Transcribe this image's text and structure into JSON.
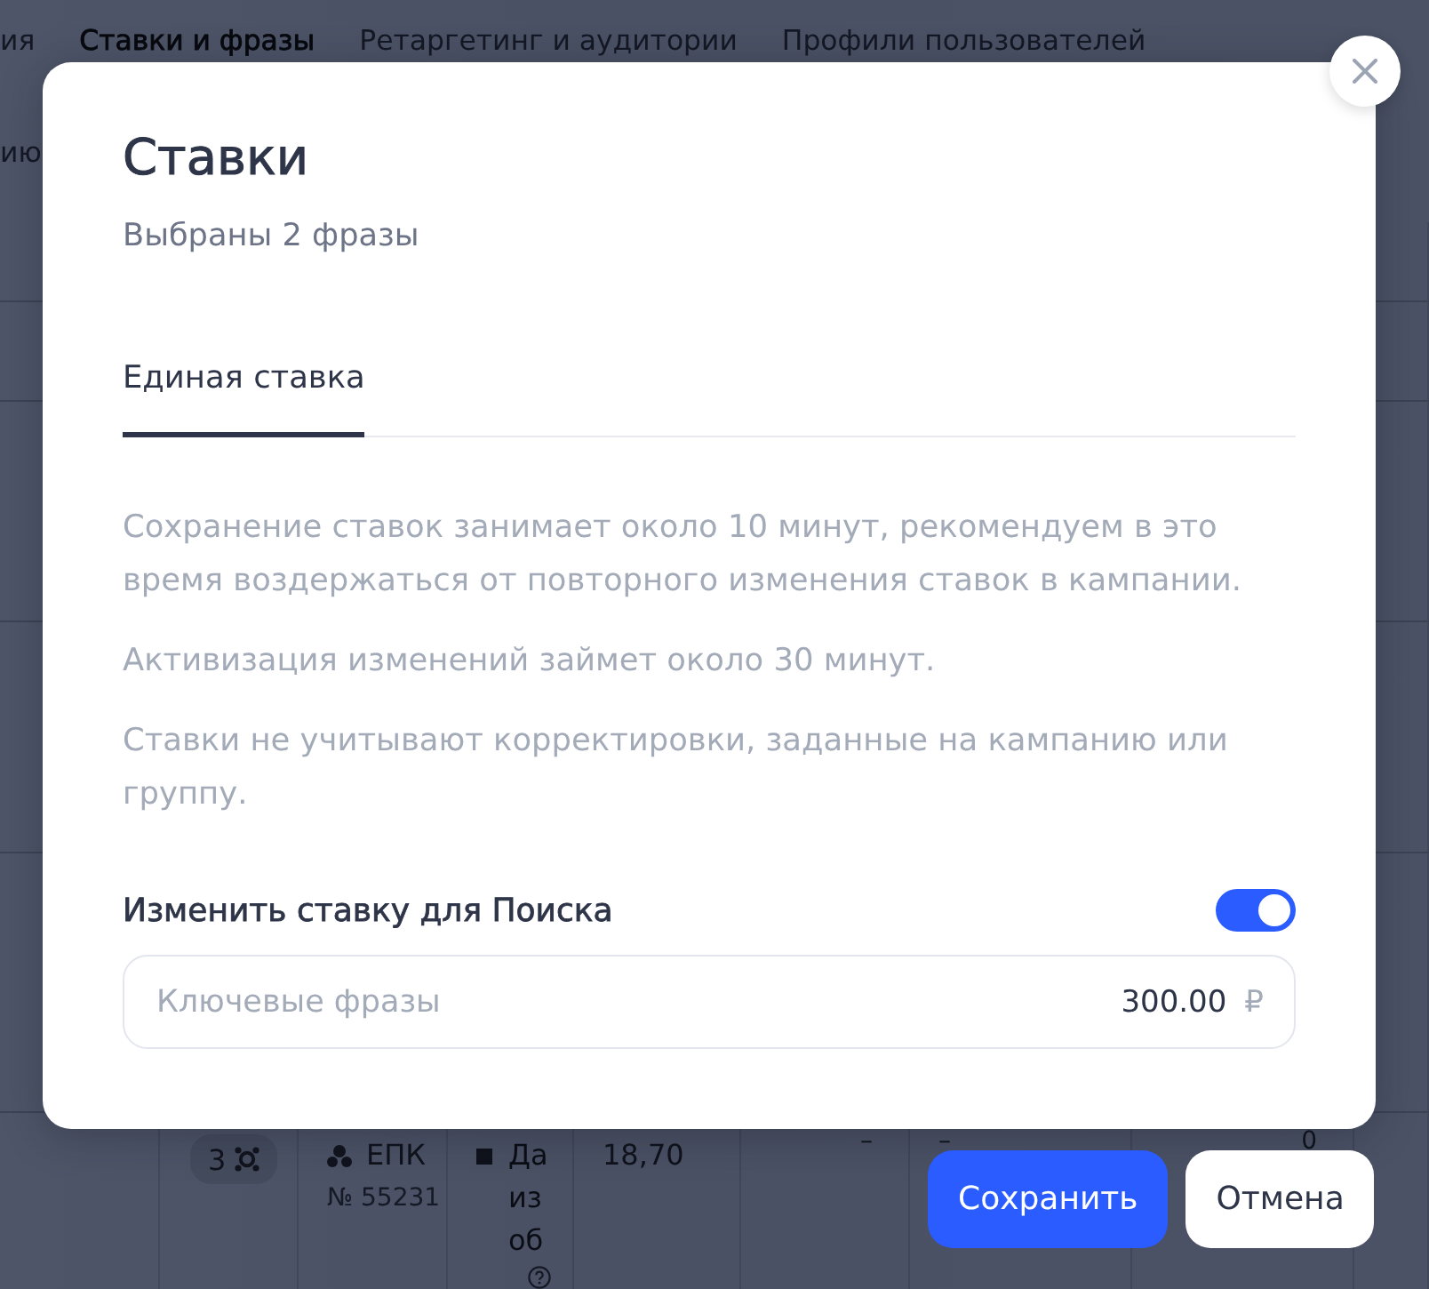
{
  "page": {
    "tabs": [
      {
        "label": "ия",
        "selected": false
      },
      {
        "label": "Ставки и фразы",
        "selected": true
      },
      {
        "label": "Ретаргетинг и аудитории",
        "selected": false
      },
      {
        "label": "Профили пользователей",
        "selected": false
      }
    ],
    "toolbar_text": "ию",
    "table_row": {
      "column_2": "3",
      "column_3": "ЕПК",
      "column_3_number": "№ 55231",
      "column_4": "Да из об",
      "column_5": "18,70",
      "column_6": "–",
      "column_7": "–",
      "column_8": "0"
    }
  },
  "dialog": {
    "title": "Ставки",
    "subtitle": "Выбраны 2 фразы",
    "tabs": [
      {
        "label": "Единая ставка",
        "selected": true
      }
    ],
    "notes": [
      "Сохранение ставок занимает около 10 минут, рекомендуем в это время воздержаться от повторного изменения ставок в кампании.",
      "Активизация изменений займет около 30 минут.",
      "Ставки не учитывают корректировки, заданные на кампанию или группу."
    ],
    "search_bid": {
      "label": "Изменить ставку для Поиска",
      "on": true,
      "field": {
        "label": "Ключевые фразы",
        "value": "300.00",
        "currency": "₽"
      }
    }
  },
  "buttons": [
    {
      "label": "Сохранить",
      "kind": "primary"
    },
    {
      "label": "Отмена",
      "kind": "secondary"
    }
  ]
}
